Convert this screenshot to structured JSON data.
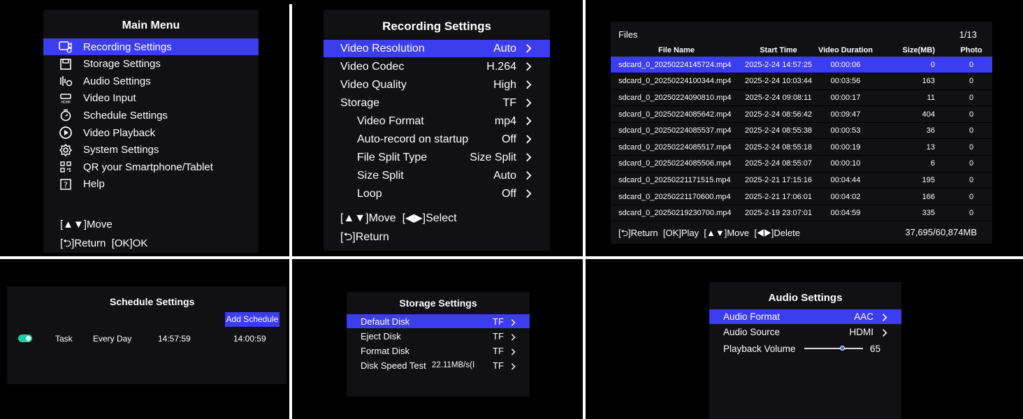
{
  "main_menu": {
    "title": "Main Menu",
    "items": [
      {
        "icon": "camera-settings-icon",
        "label": "Recording Settings"
      },
      {
        "icon": "save-icon",
        "label": "Storage Settings"
      },
      {
        "icon": "audio-icon",
        "label": "Audio Settings"
      },
      {
        "icon": "hdmi-icon",
        "label": "Video Input"
      },
      {
        "icon": "timer-icon",
        "label": "Schedule Settings"
      },
      {
        "icon": "play-icon",
        "label": "Video Playback"
      },
      {
        "icon": "gear-icon",
        "label": "System Settings"
      },
      {
        "icon": "qr-icon",
        "label": "QR your Smartphone/Tablet"
      },
      {
        "icon": "help-icon",
        "label": "Help"
      }
    ],
    "hint_move": "[▲▼]Move",
    "hint_return": "[⮌]Return  [OK]OK"
  },
  "recording_settings": {
    "title": "Recording Settings",
    "items": [
      {
        "label": "Video Resolution",
        "value": "Auto"
      },
      {
        "label": "Video Codec",
        "value": "H.264"
      },
      {
        "label": "Video Quality",
        "value": "High"
      },
      {
        "label": "Storage",
        "value": "TF"
      },
      {
        "label": "Video Format",
        "value": "mp4"
      },
      {
        "label": "Auto-record on startup",
        "value": "Off"
      },
      {
        "label": "File Split Type",
        "value": "Size Split"
      },
      {
        "label": "Size Split",
        "value": "Auto"
      },
      {
        "label": "Loop",
        "value": "Off"
      }
    ],
    "hint_move": "[▲▼]Move  [◀▶]Select",
    "hint_return": "[⮌]Return"
  },
  "files": {
    "title": "Files",
    "page": "1/13",
    "columns": [
      "File Name",
      "Start Time",
      "Video Duration",
      "Size(MB)",
      "Photo"
    ],
    "rows": [
      [
        "sdcard_0_20250224145724.mp4",
        "2025-2-24 14:57:25",
        "00:00:06",
        "0",
        "0"
      ],
      [
        "sdcard_0_20250224100344.mp4",
        "2025-2-24 10:03:44",
        "00:03:56",
        "163",
        "0"
      ],
      [
        "sdcard_0_20250224090810.mp4",
        "2025-2-24 09:08:11",
        "00:00:17",
        "11",
        "0"
      ],
      [
        "sdcard_0_20250224085642.mp4",
        "2025-2-24 08:56:42",
        "00:09:47",
        "404",
        "0"
      ],
      [
        "sdcard_0_20250224085537.mp4",
        "2025-2-24 08:55:38",
        "00:00:53",
        "36",
        "0"
      ],
      [
        "sdcard_0_20250224085517.mp4",
        "2025-2-24 08:55:18",
        "00:00:19",
        "13",
        "0"
      ],
      [
        "sdcard_0_20250224085506.mp4",
        "2025-2-24 08:55:07",
        "00:00:10",
        "6",
        "0"
      ],
      [
        "sdcard_0_20250221171515.mp4",
        "2025-2-21 17:15:16",
        "00:04:44",
        "195",
        "0"
      ],
      [
        "sdcard_0_20250221170600.mp4",
        "2025-2-21 17:06:01",
        "00:04:02",
        "166",
        "0"
      ],
      [
        "sdcard_0_20250219230700.mp4",
        "2025-2-19 23:07:01",
        "00:04:59",
        "335",
        "0"
      ]
    ],
    "hint": "[⮌]Return  [OK]Play  [▲▼]Move  [◀▶]Delete",
    "storage": "37,695/60,874MB"
  },
  "schedule_settings": {
    "title": "Schedule Settings",
    "add_label": "Add Schedule",
    "task": {
      "name": "Task",
      "repeat": "Every Day",
      "start": "14:57:59",
      "end": "14:00:59"
    }
  },
  "storage_settings": {
    "title": "Storage Settings",
    "items": [
      {
        "label": "Default Disk",
        "value": "TF",
        "extra": ""
      },
      {
        "label": "Eject Disk",
        "value": "TF",
        "extra": ""
      },
      {
        "label": "Format Disk",
        "value": "TF",
        "extra": ""
      },
      {
        "label": "Disk Speed Test",
        "value": "TF",
        "extra": "22.11MB/s(I"
      }
    ]
  },
  "audio_settings": {
    "title": "Audio Settings",
    "items": [
      {
        "label": "Audio Format",
        "value": "AAC"
      },
      {
        "label": "Audio Source",
        "value": "HDMI"
      }
    ],
    "volume_label": "Playback Volume",
    "volume_value": "65",
    "volume_level": 0.65
  },
  "colors": {
    "highlight": "#3d3df0",
    "toggle_on": "#1fd1a0"
  }
}
